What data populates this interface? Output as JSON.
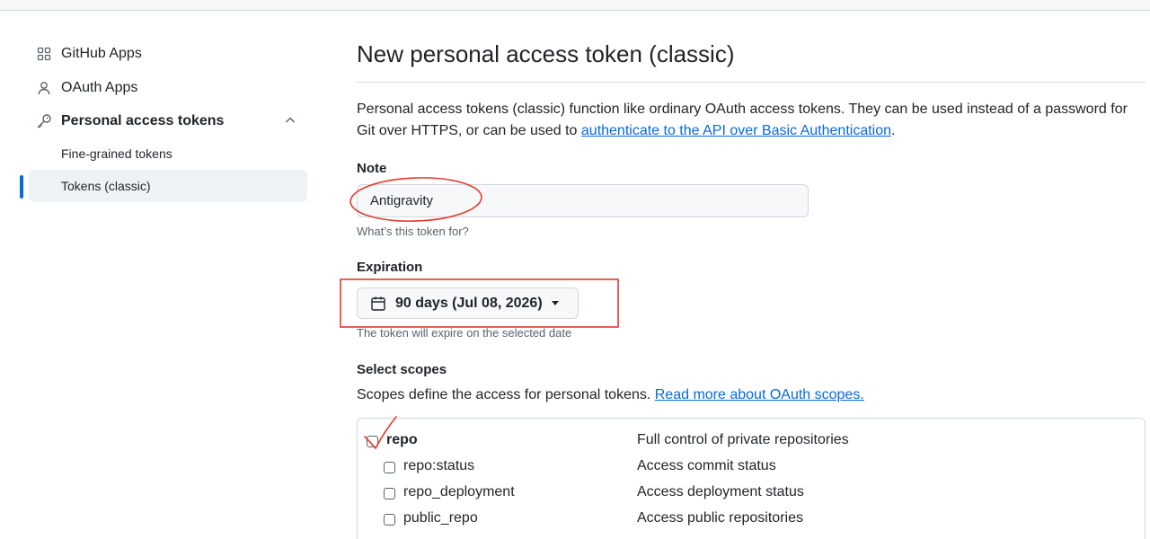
{
  "sidebar": {
    "items": [
      {
        "label": "GitHub Apps",
        "icon": "apps-grid-icon"
      },
      {
        "label": "OAuth Apps",
        "icon": "person-icon"
      },
      {
        "label": "Personal access tokens",
        "icon": "key-icon"
      }
    ],
    "sub_items": [
      {
        "label": "Fine-grained tokens"
      },
      {
        "label": "Tokens (classic)"
      }
    ]
  },
  "main": {
    "title": "New personal access token (classic)",
    "description": {
      "text_before": "Personal access tokens (classic) function like ordinary OAuth access tokens. They can be used instead of a password for Git over HTTPS, or can be used to ",
      "link_text": "authenticate to the API over Basic Authentication",
      "text_after": "."
    },
    "note": {
      "label": "Note",
      "value": "Antigravity",
      "hint": "What’s this token for?"
    },
    "expiration": {
      "label": "Expiration",
      "selected": "90 days (Jul 08, 2026)",
      "hint": "The token will expire on the selected date"
    },
    "scopes": {
      "label": "Select scopes",
      "description": "Scopes define the access for personal tokens. ",
      "link_text": "Read more about OAuth scopes.",
      "rows": [
        {
          "name": "repo",
          "desc": "Full control of private repositories"
        },
        {
          "name": "repo:status",
          "desc": "Access commit status"
        },
        {
          "name": "repo_deployment",
          "desc": "Access deployment status"
        },
        {
          "name": "public_repo",
          "desc": "Access public repositories"
        }
      ]
    }
  },
  "colors": {
    "accent": "#0969da",
    "annotation": "#e5392a"
  }
}
